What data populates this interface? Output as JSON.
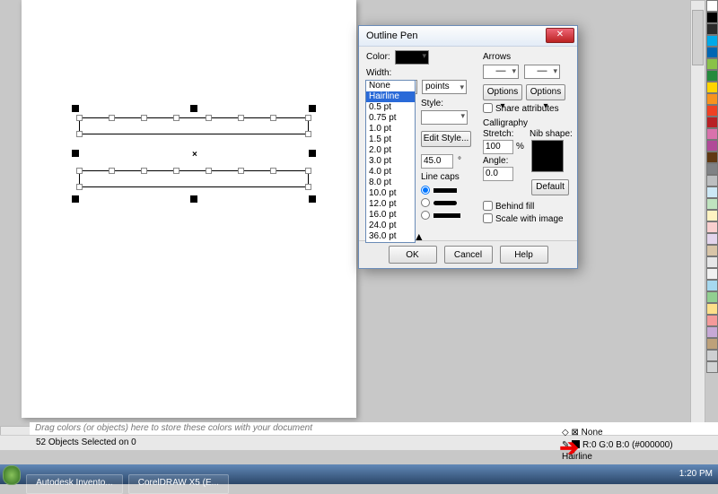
{
  "dialog": {
    "title": "Outline Pen",
    "color_label": "Color:",
    "width_label": "Width:",
    "width_value": "Hairline",
    "width_units": "points",
    "width_options": [
      "None",
      "Hairline",
      "0.5 pt",
      "0.75 pt",
      "1.0 pt",
      "1.5 pt",
      "2.0 pt",
      "3.0 pt",
      "4.0 pt",
      "8.0 pt",
      "10.0 pt",
      "12.0 pt",
      "16.0 pt",
      "24.0 pt",
      "36.0 pt"
    ],
    "style_label": "Style:",
    "edit_style": "Edit Style...",
    "miter_value": "45.0",
    "linecaps_label": "Line caps",
    "arrows_label": "Arrows",
    "arrow_opt1": "Options",
    "arrow_opt2": "Options",
    "share_attrs": "Share attributes",
    "calligraphy_label": "Calligraphy",
    "stretch_label": "Stretch:",
    "stretch_value": "100",
    "stretch_unit": "%",
    "angle_label": "Angle:",
    "angle_value": "0.0",
    "nib_label": "Nib shape:",
    "default_btn": "Default",
    "behind_fill": "Behind fill",
    "scale_image": "Scale with image",
    "ok": "OK",
    "cancel": "Cancel",
    "help": "Help"
  },
  "colorwell_hint": "Drag colors (or objects) here to store these colors with your document",
  "status": "52 Objects Selected on 0",
  "fill_none": "None",
  "outline_info": "R:0 G:0 B:0 (#000000) Hairline",
  "clock": "1:20 PM",
  "task1": "Autodesk Invento...",
  "task2": "CorelDRAW X5 (E...",
  "palette_colors": [
    "#ffffff",
    "#000000",
    "#2b2b2b",
    "#00a9e8",
    "#0066b3",
    "#8ac249",
    "#248a3d",
    "#ffd400",
    "#f7931e",
    "#ef4023",
    "#b72025",
    "#d972ac",
    "#b04a98",
    "#603913",
    "#808285",
    "#bcbec0",
    "#cde8f6",
    "#bfe3bf",
    "#fff3c2",
    "#f9cfcf",
    "#e3d5ec",
    "#d8c5a8",
    "#e6e7e8",
    "#f1f2f2",
    "#a6d8ef",
    "#91cf90",
    "#fde08a",
    "#f49a9a",
    "#c6a9d6",
    "#bda17a",
    "#ced0d2",
    "#d1d3d4"
  ]
}
